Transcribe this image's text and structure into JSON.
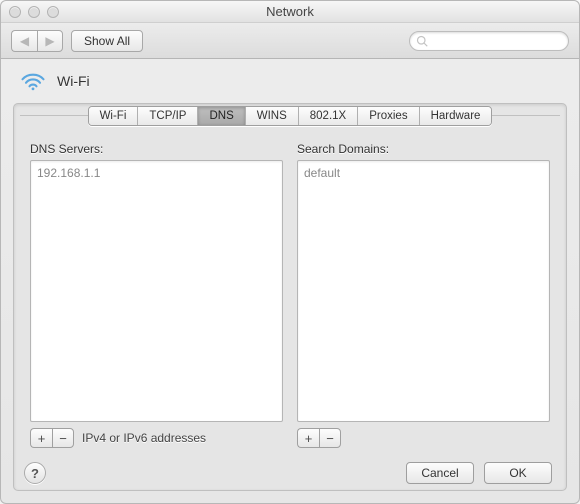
{
  "window": {
    "title": "Network"
  },
  "toolbar": {
    "show_all_label": "Show All",
    "search_placeholder": ""
  },
  "interface": {
    "name": "Wi-Fi"
  },
  "tabs": {
    "items": [
      {
        "label": "Wi-Fi"
      },
      {
        "label": "TCP/IP"
      },
      {
        "label": "DNS"
      },
      {
        "label": "WINS"
      },
      {
        "label": "802.1X"
      },
      {
        "label": "Proxies"
      },
      {
        "label": "Hardware"
      }
    ],
    "active_index": 2
  },
  "dns_panel": {
    "servers_label": "DNS Servers:",
    "servers": [
      "192.168.1.1"
    ],
    "servers_hint": "IPv4 or IPv6 addresses",
    "domains_label": "Search Domains:",
    "domains": [
      "default"
    ]
  },
  "buttons": {
    "help": "?",
    "cancel": "Cancel",
    "ok": "OK",
    "plus": "+",
    "minus": "−"
  },
  "icons": {
    "back": "◀",
    "forward": "▶"
  }
}
